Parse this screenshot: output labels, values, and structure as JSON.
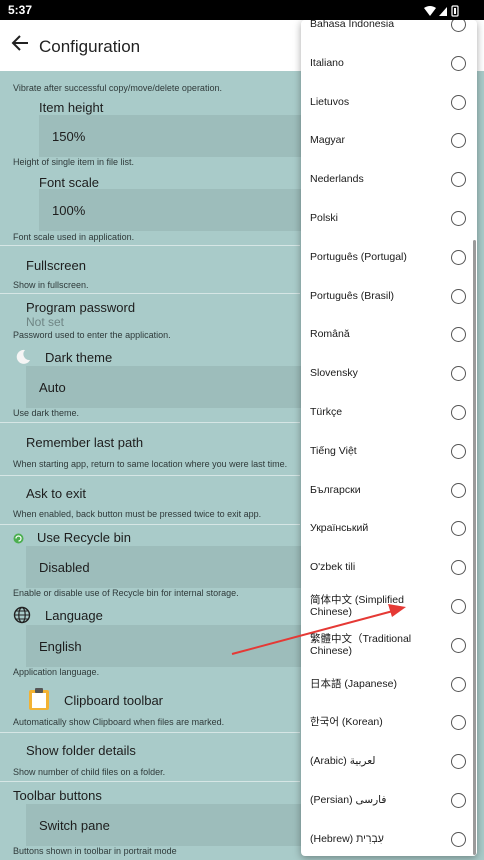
{
  "status": {
    "time": "5:37"
  },
  "header": {
    "title": "Configuration"
  },
  "settings": {
    "vibrate_desc": "Vibrate after successful copy/move/delete operation.",
    "item_height": {
      "label": "Item height",
      "value": "150%",
      "desc": "Height of single item in file list."
    },
    "font_scale": {
      "label": "Font scale",
      "value": "100%",
      "desc": "Font scale used in application."
    },
    "fullscreen": {
      "label": "Fullscreen",
      "desc": "Show in fullscreen."
    },
    "program_password": {
      "label": "Program password",
      "value": "Not set",
      "desc": "Password used to enter the application."
    },
    "dark_theme": {
      "label": "Dark theme",
      "value": "Auto",
      "desc": "Use dark theme."
    },
    "remember_path": {
      "label": "Remember last path",
      "desc": "When starting app, return to same location where you were last time."
    },
    "ask_exit": {
      "label": "Ask to exit",
      "desc": "When enabled, back button must be pressed twice to exit app."
    },
    "recycle_bin": {
      "label": "Use Recycle bin",
      "value": "Disabled",
      "desc": "Enable or disable use of Recycle bin for internal storage."
    },
    "language": {
      "label": "Language",
      "value": "English",
      "desc": "Application language."
    },
    "clipboard_toolbar": {
      "label": "Clipboard toolbar",
      "desc": "Automatically show Clipboard when files are marked."
    },
    "folder_details": {
      "label": "Show folder details",
      "desc": "Show number of child files on a folder."
    },
    "toolbar_buttons": {
      "label": "Toolbar buttons",
      "value": "Switch pane",
      "desc": "Buttons shown in toolbar in portrait mode"
    }
  },
  "languages": [
    "Bahasa Indonesia",
    "Italiano",
    "Lietuvos",
    "Magyar",
    "Nederlands",
    "Polski",
    "Português (Portugal)",
    "Português (Brasil)",
    "Română",
    "Slovensky",
    "Türkçe",
    "Tiếng Việt",
    "Български",
    "Український",
    "O'zbek tili",
    "简体中文 (Simplified Chinese)",
    "繁體中文（Traditional Chinese)",
    "日本語 (Japanese)",
    "한국어 (Korean)",
    "(Arabic) لعربية",
    "(Persian) فارسی",
    "(Hebrew) עִבְרִית"
  ],
  "colors": {
    "background": "#a9cbc9",
    "field": "#9dbdbb",
    "annotation_arrow": "#e53935"
  }
}
